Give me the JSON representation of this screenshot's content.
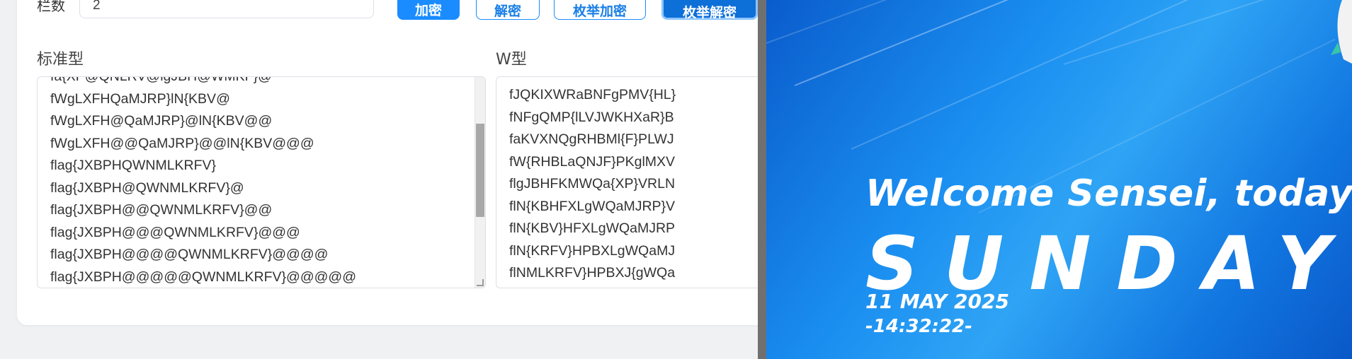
{
  "cipher": {
    "rails_label": "栏数",
    "rails_value": "2",
    "buttons": {
      "encrypt": "加密",
      "decrypt": "解密",
      "verify_encrypt": "枚举加密",
      "verify_decrypt": "枚举解密"
    },
    "standard": {
      "label": "标准型",
      "lines": [
        "fa{XP@QNLRV@lgJBH@WMKF}@",
        "fWgLXFHQaMJRP}lN{KBV@",
        "fWgLXFH@QaMJRP}@lN{KBV@@",
        "fWgLXFH@@QaMJRP}@@lN{KBV@@@",
        "flag{JXBPHQWNMLKRFV}",
        "flag{JXBPH@QWNMLKRFV}@",
        "flag{JXBPH@@QWNMLKRFV}@@",
        "flag{JXBPH@@@QWNMLKRFV}@@@",
        "flag{JXBPH@@@@QWNMLKRFV}@@@@",
        "flag{JXBPH@@@@@QWNMLKRFV}@@@@@"
      ]
    },
    "w_type": {
      "label": "W型",
      "lines": [
        "fJQKIXWRaBNFgPMV{HL}",
        "fNFgQMP{lLVJWKHXaR}B",
        "faKVXNQgRHBMl{F}PLWJ",
        "fW{RHBLaQNJF}PKglMXV",
        "flgJBHFKMWQa{XP}VRLN",
        "flN{KBHFXLgWQaMJRP}V",
        "flN{KBV}HFXLgWQaMJRP",
        "flN{KRFV}HPBXLgWQaMJ",
        "flNMLKRFV}HPBXJ{gWQa"
      ]
    }
  },
  "wallpaper": {
    "welcome": "Welcome Sensei, today is:",
    "day": "SUNDAY",
    "date": "11 MAY 2025",
    "time": "-14:32:22-"
  },
  "colors": {
    "primary": "#1a8cff",
    "wallpaper_blue": "#1a8ef0"
  }
}
